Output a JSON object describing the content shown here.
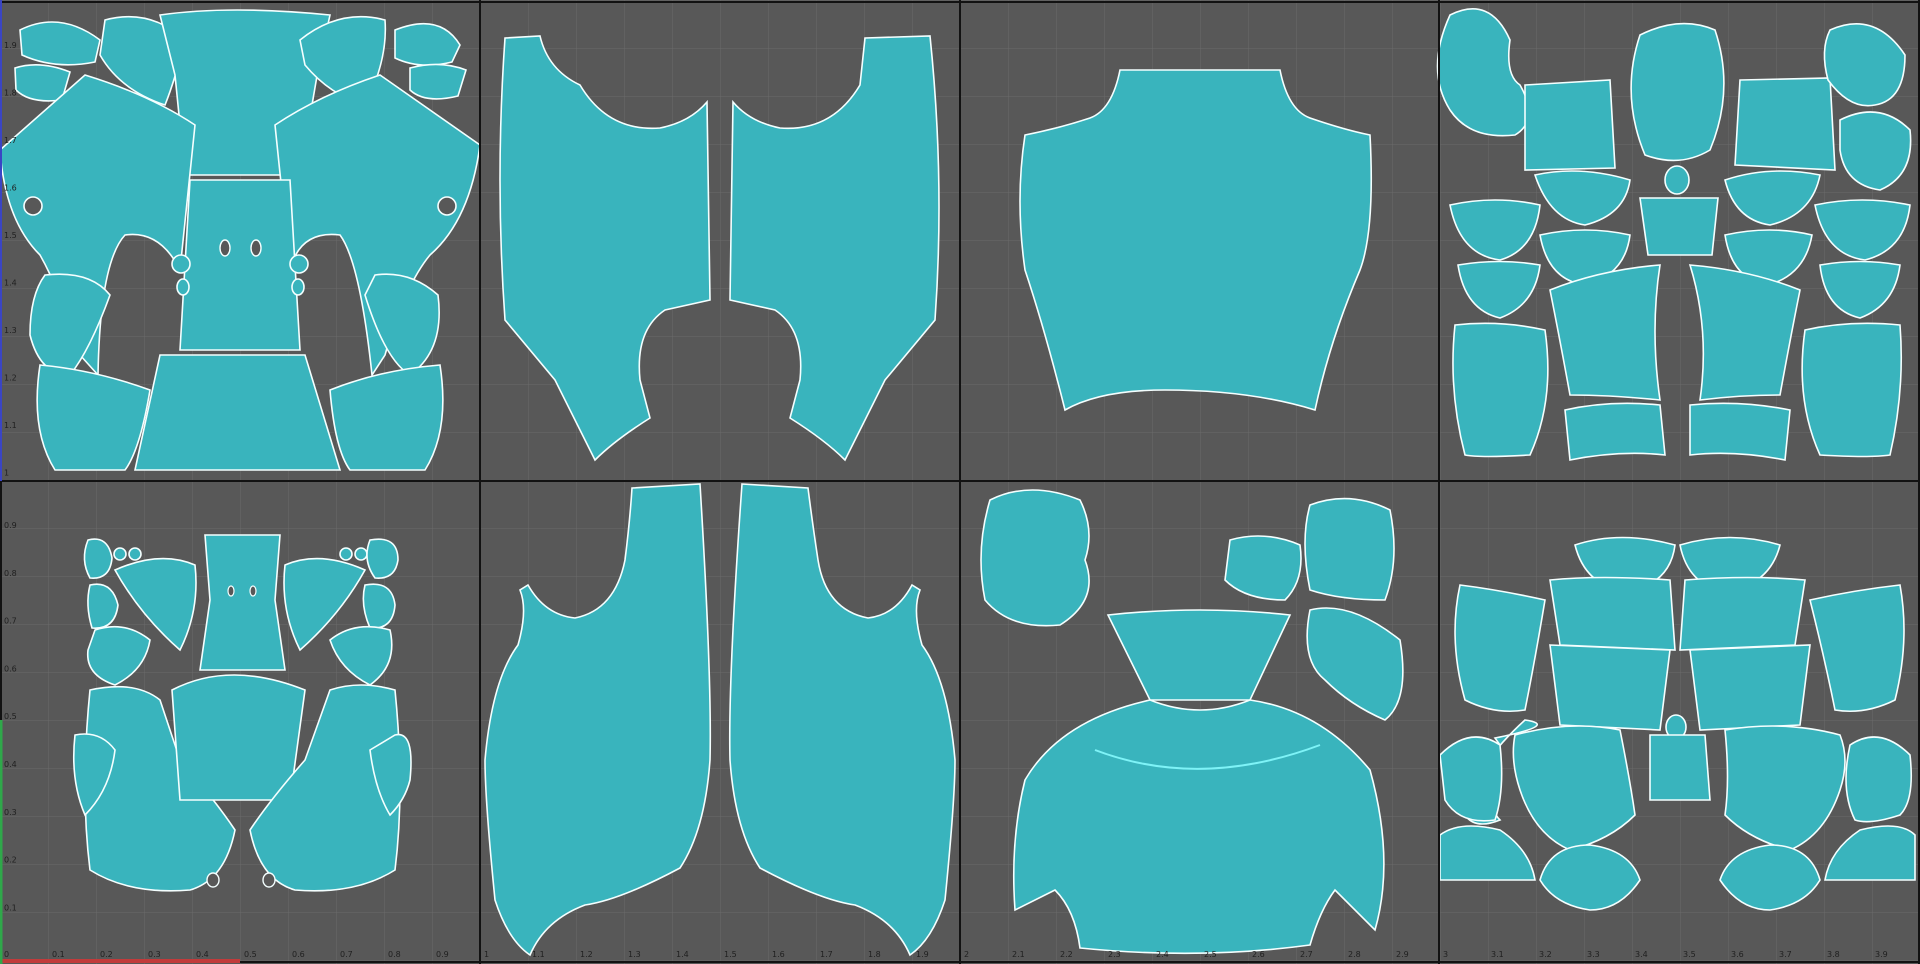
{
  "viewport": {
    "name": "UV Texture Editor",
    "background_color": "#585858",
    "grid_color": "#6a6a6a",
    "tile_border_color": "#121212",
    "shell_fill_color": "#39b4bd",
    "wire_color": "#7ef3f7",
    "border_color": "#f4ffff",
    "u_axis_color": "#c23b3b",
    "v_axis_color": "#2fa84a"
  },
  "u_ticks_row1": [
    "0",
    "0.1",
    "0.2",
    "0.3",
    "0.4",
    "0.5",
    "0.6",
    "0.7",
    "0.8",
    "0.9"
  ],
  "u_ticks_row2": [
    "1",
    "1.1",
    "1.2",
    "1.3",
    "1.4",
    "1.5",
    "1.6",
    "1.7",
    "1.8",
    "1.9"
  ],
  "u_ticks_row3": [
    "2",
    "2.1",
    "2.2",
    "2.3",
    "2.4",
    "2.5",
    "2.6",
    "2.7",
    "2.8",
    "2.9"
  ],
  "u_ticks_row4": [
    "3",
    "3.1",
    "3.2",
    "3.3",
    "3.4",
    "3.5",
    "3.6",
    "3.7",
    "3.8",
    "3.9"
  ],
  "v_ticks_lower": [
    "0.9",
    "0.8",
    "0.7",
    "0.6",
    "0.5",
    "0.4",
    "0.3",
    "0.2",
    "0.1"
  ],
  "v_ticks_upper": [
    "1.9",
    "1.8",
    "1.7",
    "1.6",
    "1.5",
    "1.4",
    "1.3",
    "1.2",
    "1.1",
    "1"
  ]
}
